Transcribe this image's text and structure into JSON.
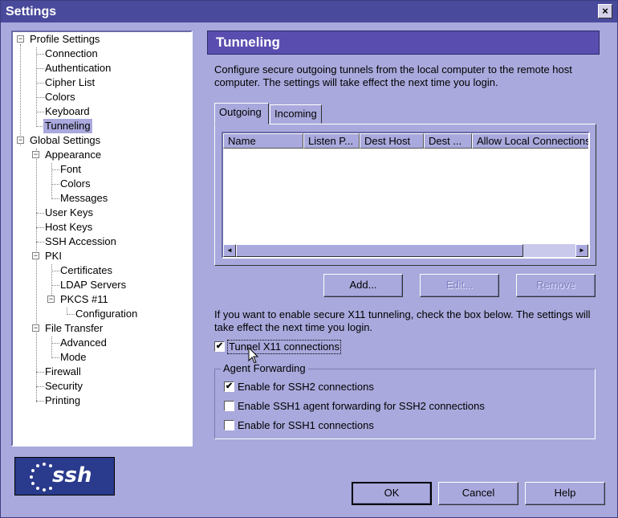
{
  "window": {
    "title": "Settings",
    "close_glyph": "×"
  },
  "tree": {
    "items": [
      {
        "label": "Profile Settings",
        "expander": "−"
      },
      {
        "label": "Connection"
      },
      {
        "label": "Authentication"
      },
      {
        "label": "Cipher List"
      },
      {
        "label": "Colors"
      },
      {
        "label": "Keyboard"
      },
      {
        "label": "Tunneling",
        "selected": true
      },
      {
        "label": "Global Settings",
        "expander": "−"
      },
      {
        "label": "Appearance",
        "expander": "−"
      },
      {
        "label": "Font"
      },
      {
        "label": "Colors"
      },
      {
        "label": "Messages"
      },
      {
        "label": "User Keys"
      },
      {
        "label": "Host Keys"
      },
      {
        "label": "SSH Accession"
      },
      {
        "label": "PKI",
        "expander": "−"
      },
      {
        "label": "Certificates"
      },
      {
        "label": "LDAP Servers"
      },
      {
        "label": "PKCS #11",
        "expander": "−"
      },
      {
        "label": "Configuration"
      },
      {
        "label": "File Transfer",
        "expander": "−"
      },
      {
        "label": "Advanced"
      },
      {
        "label": "Mode"
      },
      {
        "label": "Firewall"
      },
      {
        "label": "Security"
      },
      {
        "label": "Printing"
      }
    ]
  },
  "logo": {
    "text": "ssh"
  },
  "panel": {
    "heading": "Tunneling",
    "description": "Configure secure outgoing tunnels from the local computer to the remote host computer. The settings will take effect the next time you login.",
    "tabs": [
      {
        "label": "Outgoing",
        "active": true
      },
      {
        "label": "Incoming"
      }
    ],
    "columns": [
      "Name",
      "Listen P...",
      "Dest Host",
      "Dest ...",
      "Allow Local Connections"
    ],
    "scroll_left": "◄",
    "scroll_right": "►",
    "buttons": {
      "add": "Add...",
      "edit": "Edit...",
      "remove": "Remove"
    },
    "x11_description": "If you want to enable secure X11 tunneling, check the box below. The settings will take effect the next time you login.",
    "x11_checkbox": {
      "label": "Tunnel X11 connections",
      "checked": true
    },
    "agent_forwarding": {
      "title": "Agent Forwarding",
      "options": [
        {
          "label": "Enable for SSH2 connections",
          "checked": true
        },
        {
          "label": "Enable SSH1 agent forwarding for SSH2 connections",
          "checked": false
        },
        {
          "label": "Enable for SSH1 connections",
          "checked": false
        }
      ]
    },
    "check_glyph": "✔"
  },
  "footer": {
    "ok": "OK",
    "cancel": "Cancel",
    "help": "Help"
  }
}
